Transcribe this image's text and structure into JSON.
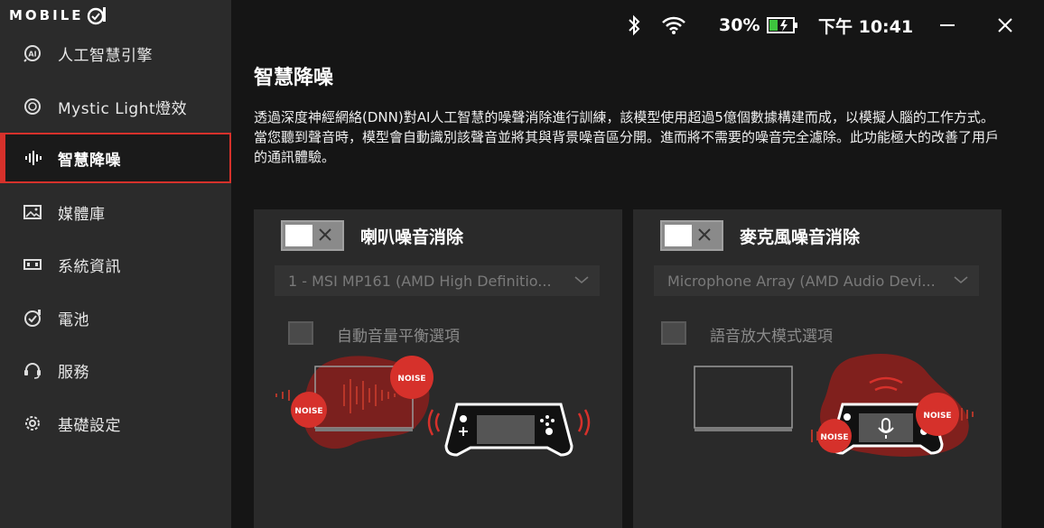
{
  "app": {
    "logo_text": "MOBILE",
    "logo_mark": "01"
  },
  "sidebar": {
    "items": [
      {
        "label": "人工智慧引擎",
        "icon": "ai-chip-icon"
      },
      {
        "label": "Mystic Light燈效",
        "icon": "mystic-light-icon"
      },
      {
        "label": "智慧降噪",
        "icon": "noise-wave-icon"
      },
      {
        "label": "媒體庫",
        "icon": "media-image-icon"
      },
      {
        "label": "系統資訊",
        "icon": "system-info-icon"
      },
      {
        "label": "電池",
        "icon": "battery-check-icon"
      },
      {
        "label": "服務",
        "icon": "headset-service-icon"
      },
      {
        "label": "基礎設定",
        "icon": "gear-icon"
      }
    ],
    "active_index": 2
  },
  "topbar": {
    "battery_percent": "30%",
    "time": "下午 10:41",
    "battery_level": 0.3,
    "battery_charging": true
  },
  "main": {
    "title": "智慧降噪",
    "description": "透過深度神經網絡(DNN)對AI人工智慧的噪聲消除進行訓練，該模型使用超過5億個數據構建而成，以模擬人腦的工作方式。當您聽到聲音時，模型會自動識別該聲音並將其與背景噪音區分開。進而將不需要的噪音完全濾除。此功能極大的改善了用戶的通訊體驗。",
    "speaker_panel": {
      "title": "喇叭噪音消除",
      "toggle_on": false,
      "device": "1 - MSI MP161 (AMD High Definitio...",
      "option_label": "自動音量平衡選項",
      "noise_label_1": "NOISE",
      "noise_label_2": "NOISE"
    },
    "mic_panel": {
      "title": "麥克風噪音消除",
      "toggle_on": false,
      "device": "Microphone Array (AMD Audio Devi...",
      "option_label": "語音放大模式選項",
      "noise_label_1": "NOISE",
      "noise_label_2": "NOISE"
    }
  },
  "colors": {
    "accent": "#d6312b",
    "sidebar_bg": "#2b2b2b",
    "main_bg": "#151515",
    "panel_bg": "#2a2a2a",
    "battery_green": "#3ec43e"
  }
}
